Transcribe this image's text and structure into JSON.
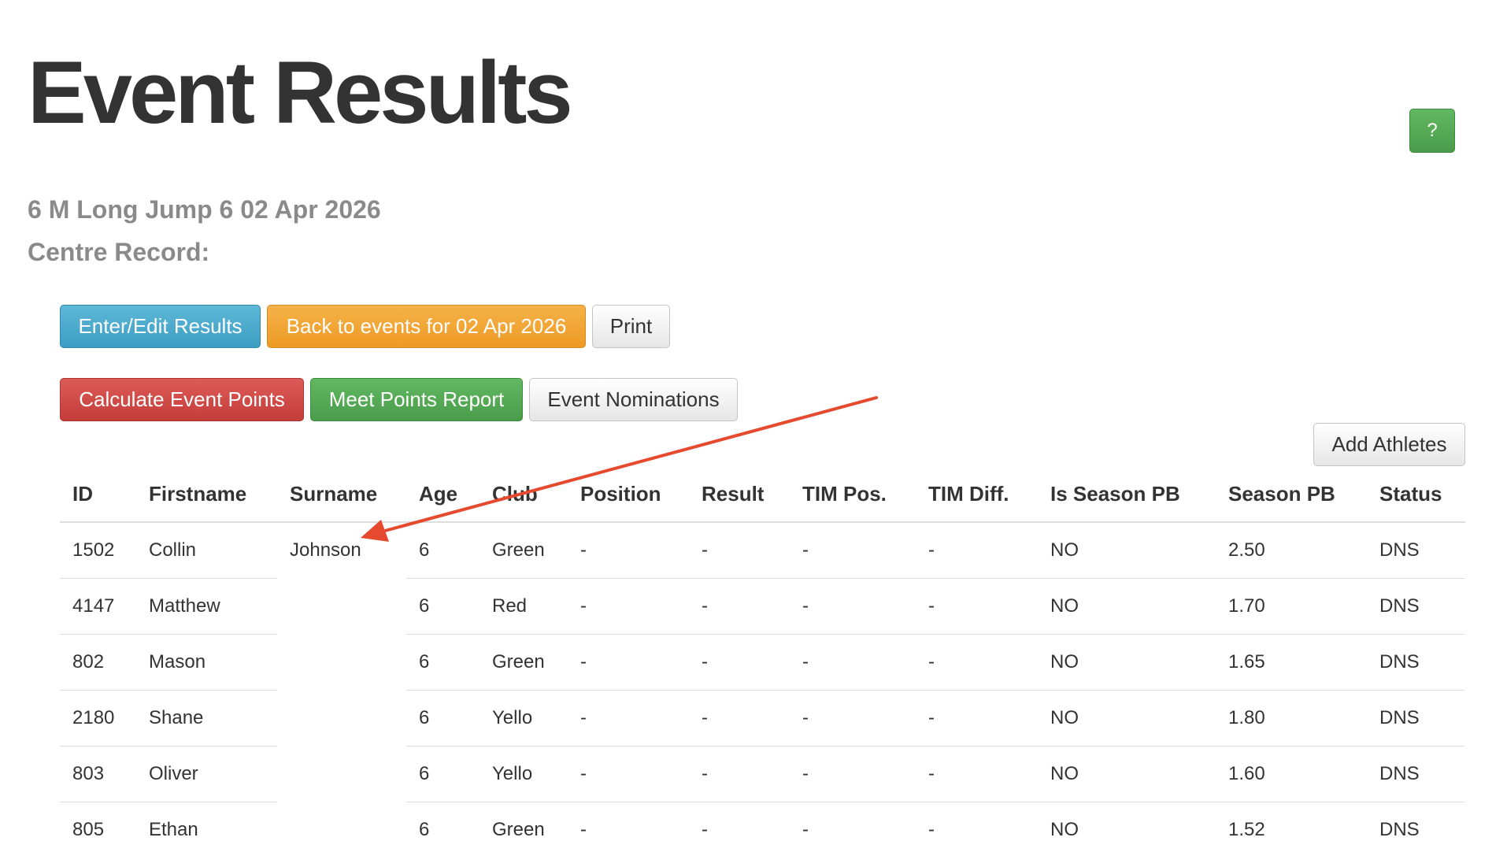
{
  "page": {
    "title": "Event Results",
    "help_label": "?",
    "event_name": "6 M Long Jump 6 02 Apr 2026",
    "centre_record_label": "Centre Record:"
  },
  "toolbar": {
    "enter_edit_label": "Enter/Edit Results",
    "back_label": "Back to events for 02 Apr 2026",
    "print_label": "Print",
    "calculate_points_label": "Calculate Event Points",
    "meet_points_label": "Meet Points Report",
    "nominations_label": "Event Nominations",
    "add_athletes_label": "Add Athletes"
  },
  "table": {
    "headers": [
      "ID",
      "Firstname",
      "Surname",
      "Age",
      "Club",
      "Position",
      "Result",
      "TIM Pos.",
      "TIM Diff.",
      "Is Season PB",
      "Season PB",
      "Status"
    ],
    "rows": [
      [
        "1502",
        "Collin",
        "Johnson",
        "6",
        "Green",
        "-",
        "-",
        "-",
        "-",
        "NO",
        "2.50",
        "DNS"
      ],
      [
        "4147",
        "Matthew",
        "",
        "6",
        "Red",
        "-",
        "-",
        "-",
        "-",
        "NO",
        "1.70",
        "DNS"
      ],
      [
        "802",
        "Mason",
        "",
        "6",
        "Green",
        "-",
        "-",
        "-",
        "-",
        "NO",
        "1.65",
        "DNS"
      ],
      [
        "2180",
        "Shane",
        "",
        "6",
        "Yello",
        "-",
        "-",
        "-",
        "-",
        "NO",
        "1.80",
        "DNS"
      ],
      [
        "803",
        "Oliver",
        "",
        "6",
        "Yello",
        "-",
        "-",
        "-",
        "-",
        "NO",
        "1.60",
        "DNS"
      ],
      [
        "805",
        "Ethan",
        "",
        "6",
        "Green",
        "-",
        "-",
        "-",
        "-",
        "NO",
        "1.52",
        "DNS"
      ]
    ]
  },
  "colors": {
    "link": "#2a7bc8",
    "arrow": "#e64a2e",
    "info": "#48a9cf",
    "warning": "#f0a432",
    "danger": "#cf4844",
    "success": "#55a955"
  }
}
